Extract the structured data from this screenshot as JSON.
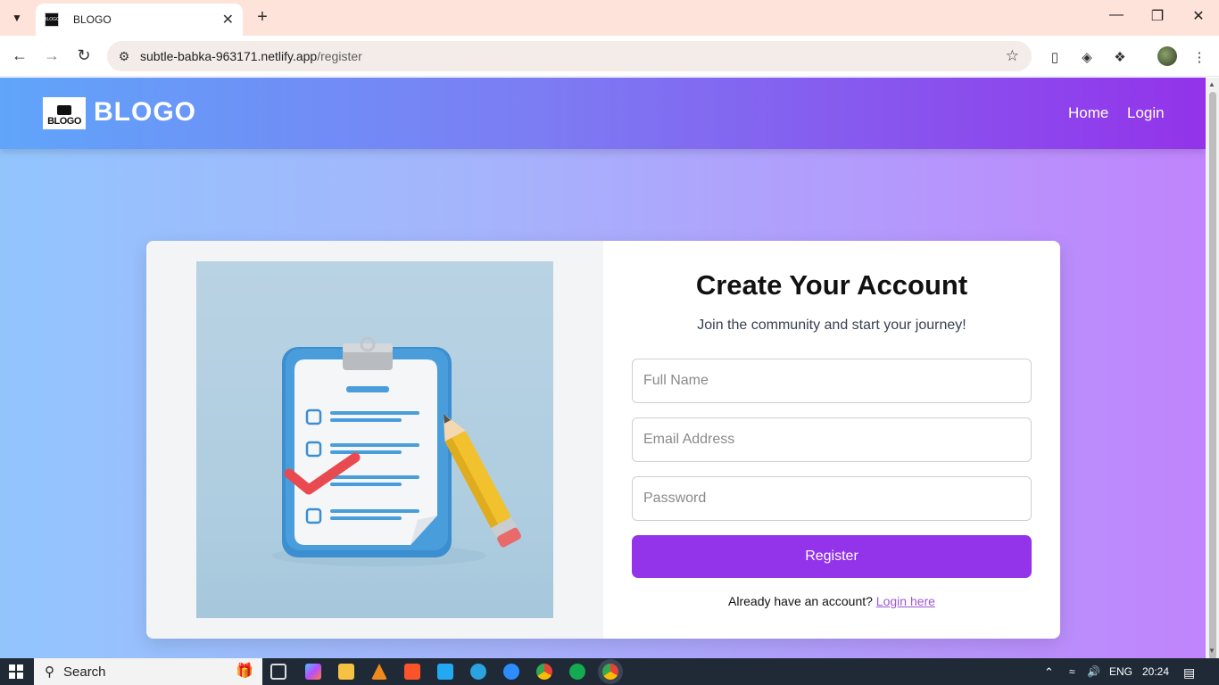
{
  "browser": {
    "tab_title": "BLOGO",
    "tab_favicon_text": "BLOGO",
    "url_host": "subtle-babka-963171.netlify.app",
    "url_path": "/register",
    "icons": [
      "chevron-down-icon",
      "close-icon",
      "plus-icon",
      "minimize-icon",
      "restore-icon",
      "close-window-icon",
      "back-icon",
      "forward-icon",
      "reload-icon",
      "site-settings-icon",
      "star-icon",
      "wallet-icon",
      "extension-cat-icon",
      "puzzle-icon",
      "profile-avatar",
      "kebab-menu-icon"
    ]
  },
  "header": {
    "logo_image_text": "BLOGO",
    "logo_text": "BLOGO",
    "nav": [
      {
        "label": "Home"
      },
      {
        "label": "Login"
      }
    ]
  },
  "register": {
    "heading": "Create Your Account",
    "subtitle": "Join the community and start your journey!",
    "fields": [
      {
        "placeholder": "Full Name",
        "value": ""
      },
      {
        "placeholder": "Email Address",
        "value": ""
      },
      {
        "placeholder": "Password",
        "value": ""
      }
    ],
    "submit_label": "Register",
    "login_prompt": "Already have an account?",
    "login_link": "Login here"
  },
  "colors": {
    "accent": "#9333ea",
    "header_start": "#60a5fa",
    "header_end": "#9333ea",
    "link": "#9b59d0"
  },
  "taskbar": {
    "search_label": "Search",
    "language": "ENG",
    "time": "20:24"
  }
}
